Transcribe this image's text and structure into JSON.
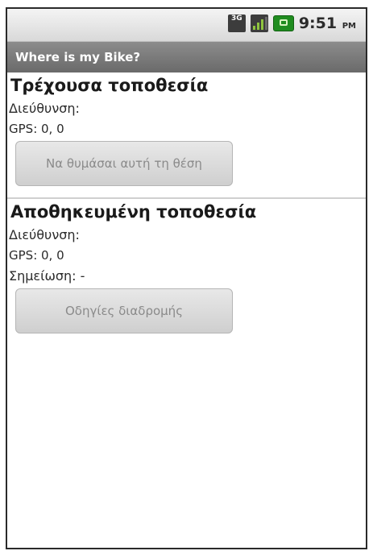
{
  "status": {
    "network_badge": "3G",
    "time": "9:51",
    "ampm": "PM"
  },
  "app": {
    "title": "Where is my Bike?"
  },
  "current": {
    "heading": "Τρέχουσα τοποθεσία",
    "address": "Διεύθυνση:",
    "gps": "GPS: 0, 0",
    "button": "Να θυμάσαι αυτή τη θέση"
  },
  "saved": {
    "heading": "Αποθηκευμένη τοποθεσία",
    "address": "Διεύθυνση:",
    "gps": "GPS: 0, 0",
    "note": "Σημείωση: -",
    "button": "Οδηγίες διαδρομής"
  }
}
